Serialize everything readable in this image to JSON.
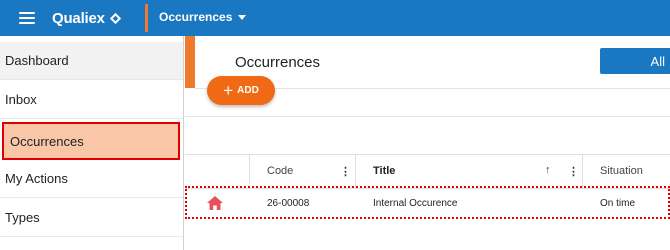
{
  "topbar": {
    "brand": "Qualiex",
    "module": "Occurrences",
    "colors": {
      "bar": "#1a78c2",
      "accent": "#f07a2b"
    }
  },
  "sidebar": {
    "items": [
      {
        "label": "Dashboard"
      },
      {
        "label": "Inbox"
      },
      {
        "label": "Occurrences"
      },
      {
        "label": "My Actions"
      },
      {
        "label": "Types"
      }
    ]
  },
  "main": {
    "title": "Occurrences",
    "all_label": "All",
    "add_label": "ADD",
    "columns": {
      "code": "Code",
      "title": "Title",
      "situation": "Situation"
    },
    "rows": [
      {
        "icon": "home-icon",
        "code": "26-00008",
        "title": "Internal Occurence",
        "situation": "On time"
      }
    ]
  }
}
